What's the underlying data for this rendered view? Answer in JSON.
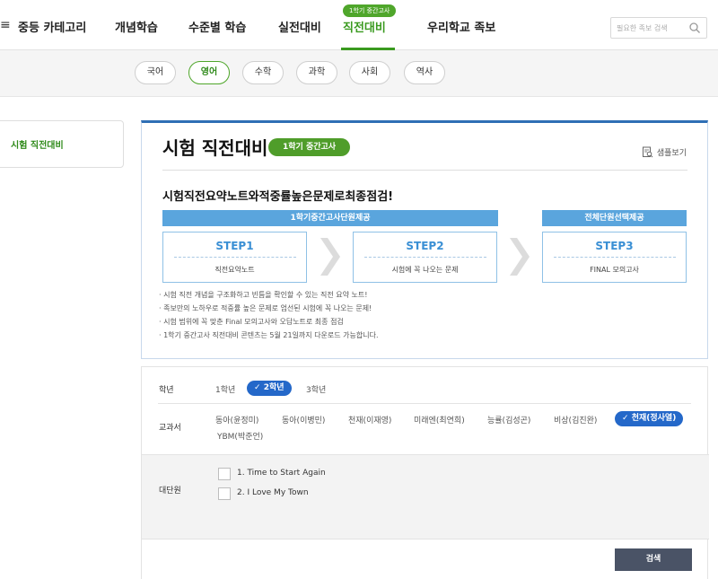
{
  "topnav": {
    "menu_glyph": "≡",
    "items": [
      {
        "label": "중등 카테고리"
      },
      {
        "label": "개념학습"
      },
      {
        "label": "수준별 학습"
      },
      {
        "label": "실전대비"
      },
      {
        "label": "직전대비",
        "active": true
      },
      {
        "label": "우리학교 족보"
      }
    ],
    "active_tag": "1학기 중간고사",
    "search": {
      "placeholder": "필요한 족보 검색"
    }
  },
  "subjects": [
    {
      "label": "국어"
    },
    {
      "label": "영어",
      "active": true
    },
    {
      "label": "수학"
    },
    {
      "label": "과학"
    },
    {
      "label": "사회"
    },
    {
      "label": "역사"
    }
  ],
  "sidebar": {
    "item": "시험 직전대비"
  },
  "card": {
    "title": "시험 직전대비",
    "badge": "1학기 중간고사",
    "sample_label": "샘플보기",
    "headline": "시험직전요약노트와적중률높은문제로최종점검!",
    "bar_left": "1학기중간고사단원제공",
    "bar_right": "전체단원선택제공",
    "steps": [
      {
        "title": "STEP1",
        "desc": "직전요약노트"
      },
      {
        "title": "STEP2",
        "desc": "시험에 꼭 나오는 문제"
      },
      {
        "title": "STEP3",
        "desc": "FINAL 모의고사"
      }
    ],
    "notes": [
      "시험 직전 개념을 구조화하고 빈틈을 확인할 수 있는 직전 요약 노트!",
      "족보만의 노하우로 적중률 높은 문제로 엄선된 시험에 꼭 나오는 문제!",
      "시험 범위에 꼭 맞춘 Final 모의고사와 오답노트로 최종 점검",
      "1학기 중간고사 직전대비 콘텐츠는 5월 21일까지 다운로드 가능합니다."
    ]
  },
  "filter": {
    "grade_label": "학년",
    "grades": [
      "1학년",
      "2학년",
      "3학년"
    ],
    "grade_selected": "2학년",
    "textbook_label": "교과서",
    "textbooks": [
      "동아(윤정미)",
      "동아(이병민)",
      "천재(이재영)",
      "미래엔(최연희)",
      "능률(김성곤)",
      "비상(김진완)",
      "천재(정사열)",
      "YBM(박준언)"
    ],
    "textbook_selected": "천재(정사열)",
    "unit_label": "대단원",
    "units": [
      "1. Time to Start Again",
      "2. I Love My Town"
    ],
    "search_button": "검색"
  },
  "colors": {
    "accent_green": "#3a9a1f",
    "accent_blue": "#2468c9",
    "step_blue": "#5aa5dd",
    "button_dark": "#4a5366"
  }
}
